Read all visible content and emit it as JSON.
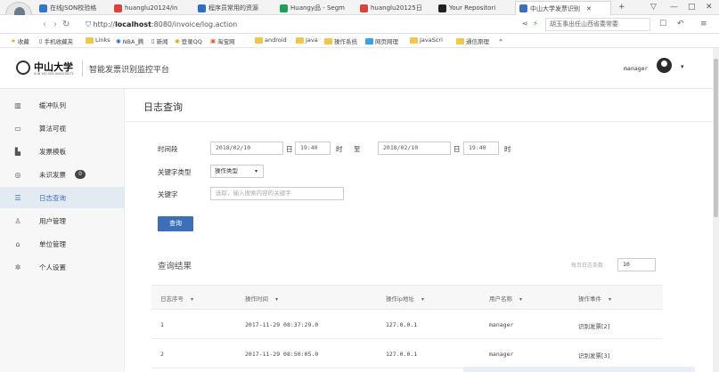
{
  "browser": {
    "tabs": [
      {
        "label": "在线JSON校验格",
        "color": "#2f78d0"
      },
      {
        "label": "huanglu20124/in",
        "color": "#d9433a"
      },
      {
        "label": "程序员常用的资源",
        "color": "#2a6fc6"
      },
      {
        "label": "Huangy品 - Segm",
        "color": "#1f9f57"
      },
      {
        "label": "huanglu20125日",
        "color": "#d9433a"
      },
      {
        "label": "Your Repositori",
        "color": "#222222"
      },
      {
        "label": "中山大学发票识别",
        "color": "#3b6fb6"
      }
    ],
    "new_tab": "+",
    "window_controls": [
      "▽",
      "—",
      "□",
      "✕"
    ],
    "url_prefix": "http://",
    "url_host": "localhost",
    "url_rest": ":8080/invoice/log.action",
    "search_placeholder": "胡玉事出任山西省委常委",
    "bookmarks": [
      "收藏",
      "手机收藏夹",
      "Links",
      "NBA_腾",
      "新闻",
      "登录QQ",
      "淘宝网",
      "android",
      "Java",
      "操作系统",
      "网页网理",
      "JavaScri",
      "通信原理",
      "»"
    ]
  },
  "header": {
    "logo_text": "中山大学",
    "logo_sub": "SUN YAT-SEN UNIVERSITY",
    "site_title": "智能发票识别监控平台",
    "username": "manager",
    "user_caret": "▾"
  },
  "sidebar": {
    "items": [
      {
        "label": "缓冲队列",
        "icon": "▥",
        "active": false
      },
      {
        "label": "算法可视",
        "icon": "▭",
        "active": false
      },
      {
        "label": "发票模板",
        "icon": "▙",
        "active": false
      },
      {
        "label": "未识发票",
        "icon": "◎",
        "active": false,
        "badge": "0"
      },
      {
        "label": "日志查询",
        "icon": "☰",
        "active": true
      },
      {
        "label": "用户管理",
        "icon": "♙",
        "active": false
      },
      {
        "label": "单位管理",
        "icon": "⌂",
        "active": false
      },
      {
        "label": "个人设置",
        "icon": "✲",
        "active": false
      }
    ]
  },
  "main": {
    "title": "日志查询",
    "form": {
      "time_label": "时间段",
      "start_date": "2018/02/10",
      "day_unit": "日",
      "start_time": "19:40",
      "hour_unit": "时",
      "to": "至",
      "end_date": "2018/02/10",
      "end_time": "19:40",
      "keyword_type_label": "关键字类型",
      "keyword_type_value": "操作类型",
      "keyword_label": "关键字",
      "keyword_placeholder": "选取，输入搜索内容的关键字",
      "query_button": "查询"
    },
    "results": {
      "title": "查询结果",
      "page_size_label": "每页日志条数",
      "page_size": "10",
      "columns": [
        "日志序号",
        "操作时间",
        "操作ip地址",
        "用户名称",
        "操作事件"
      ],
      "rows": [
        [
          "1",
          "2017-11-29 08:37:29.0",
          "127.0.0.1",
          "manager",
          "识别发票[2]"
        ],
        [
          "2",
          "2017-11-29 08:50:05.0",
          "127.0.0.1",
          "manager",
          "识别发票[3]"
        ]
      ]
    }
  }
}
